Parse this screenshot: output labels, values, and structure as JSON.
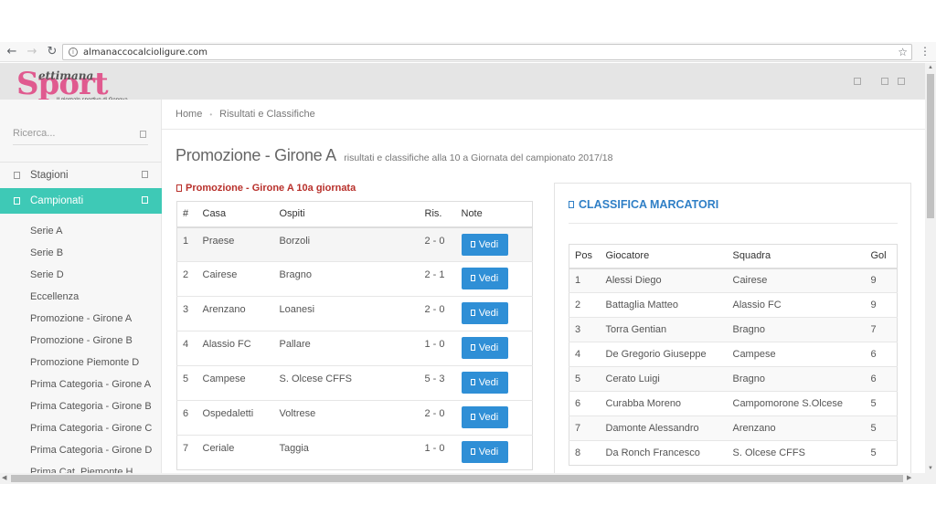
{
  "browser": {
    "url": "almanaccocalcioligure.com"
  },
  "logo": {
    "small": "ettimana",
    "big": "Sport",
    "tagline": "Il giornale sportivo di Genova"
  },
  "sidebar": {
    "search_placeholder": "Ricerca...",
    "items": [
      {
        "label": "Stagioni"
      },
      {
        "label": "Campionati"
      }
    ],
    "sub_items": [
      "Serie A",
      "Serie B",
      "Serie D",
      "Eccellenza",
      "Promozione - Girone A",
      "Promozione - Girone B",
      "Promozione Piemonte D",
      "Prima Categoria - Girone A",
      "Prima Categoria - Girone B",
      "Prima Categoria - Girone C",
      "Prima Categoria - Girone D",
      "Prima Cat. Piemonte H"
    ]
  },
  "breadcrumb": {
    "home": "Home",
    "current": "Risultati e Classifiche"
  },
  "page": {
    "title": "Promozione - Girone A",
    "subtitle": "risultati e classifiche alla 10 a Giornata del campionato 2017/18"
  },
  "results": {
    "heading": "Promozione - Girone A 10a giornata",
    "columns": [
      "#",
      "Casa",
      "Ospiti",
      "Ris.",
      "Note"
    ],
    "button_label": "Vedi",
    "rows": [
      {
        "n": "1",
        "home": "Praese",
        "away": "Borzoli",
        "score": "2 - 0"
      },
      {
        "n": "2",
        "home": "Cairese",
        "away": "Bragno",
        "score": "2 - 1"
      },
      {
        "n": "3",
        "home": "Arenzano",
        "away": "Loanesi",
        "score": "2 - 0"
      },
      {
        "n": "4",
        "home": "Alassio FC",
        "away": "Pallare",
        "score": "1 - 0"
      },
      {
        "n": "5",
        "home": "Campese",
        "away": "S. Olcese CFFS",
        "score": "5 - 3"
      },
      {
        "n": "6",
        "home": "Ospedaletti",
        "away": "Voltrese",
        "score": "2 - 0"
      },
      {
        "n": "7",
        "home": "Ceriale",
        "away": "Taggia",
        "score": "1 - 0"
      }
    ]
  },
  "scorers": {
    "title": "CLASSIFICA MARCATORI",
    "columns": [
      "Pos",
      "Giocatore",
      "Squadra",
      "Gol"
    ],
    "rows": [
      {
        "pos": "1",
        "player": "Alessi Diego",
        "team": "Cairese",
        "goals": "9"
      },
      {
        "pos": "2",
        "player": "Battaglia Matteo",
        "team": "Alassio FC",
        "goals": "9"
      },
      {
        "pos": "3",
        "player": "Torra Gentian",
        "team": "Bragno",
        "goals": "7"
      },
      {
        "pos": "4",
        "player": "De Gregorio Giuseppe",
        "team": "Campese",
        "goals": "6"
      },
      {
        "pos": "5",
        "player": "Cerato Luigi",
        "team": "Bragno",
        "goals": "6"
      },
      {
        "pos": "6",
        "player": "Curabba Moreno",
        "team": "Campomorone S.Olcese",
        "goals": "5"
      },
      {
        "pos": "7",
        "player": "Damonte Alessandro",
        "team": "Arenzano",
        "goals": "5"
      },
      {
        "pos": "8",
        "player": "Da Ronch Francesco",
        "team": "S. Olcese CFFS",
        "goals": "5"
      }
    ]
  }
}
